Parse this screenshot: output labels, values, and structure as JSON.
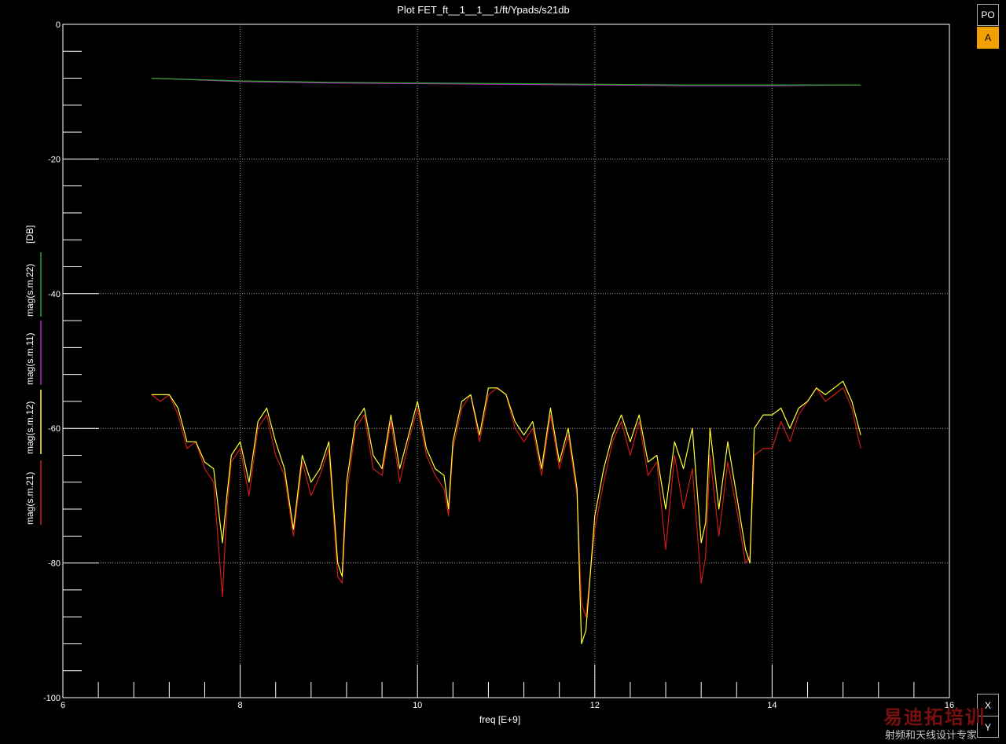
{
  "window": {
    "title": "Plot FET_ft__1__1__1/ft/Ypads/s21db",
    "buttons": {
      "po": "PO",
      "a": "A",
      "x": "X",
      "y": "Y"
    }
  },
  "watermark": {
    "top": "易迪拓培训",
    "bottom": "射频和天线设计专家"
  },
  "chart_data": {
    "type": "line",
    "title": "Plot FET_ft__1__1__1/ft/Ypads/s21db",
    "xlabel": "freq  [E+9]",
    "ylabel_unit": "[DB]",
    "xlim": [
      6,
      16
    ],
    "ylim": [
      -100,
      0
    ],
    "xticks": [
      6,
      8,
      10,
      12,
      14,
      16
    ],
    "yticks": [
      0,
      -20,
      -40,
      -60,
      -80,
      -100
    ],
    "grid": true,
    "legend": "left-vertical",
    "series": [
      {
        "name": "mag(s.m.21)",
        "color": "#d01a1a",
        "x": [
          7.0,
          7.1,
          7.2,
          7.3,
          7.4,
          7.5,
          7.6,
          7.7,
          7.8,
          7.85,
          7.9,
          8.0,
          8.1,
          8.2,
          8.3,
          8.4,
          8.5,
          8.6,
          8.7,
          8.8,
          8.9,
          9.0,
          9.1,
          9.15,
          9.2,
          9.3,
          9.4,
          9.5,
          9.6,
          9.7,
          9.8,
          9.9,
          10.0,
          10.1,
          10.2,
          10.3,
          10.35,
          10.4,
          10.5,
          10.6,
          10.7,
          10.8,
          10.9,
          11.0,
          11.1,
          11.2,
          11.3,
          11.4,
          11.5,
          11.6,
          11.7,
          11.8,
          11.85,
          11.9,
          12.0,
          12.1,
          12.2,
          12.3,
          12.4,
          12.5,
          12.6,
          12.7,
          12.8,
          12.9,
          13.0,
          13.1,
          13.2,
          13.25,
          13.3,
          13.4,
          13.5,
          13.6,
          13.7,
          13.75,
          13.8,
          13.9,
          14.0,
          14.1,
          14.2,
          14.3,
          14.4,
          14.5,
          14.6,
          14.7,
          14.8,
          14.9,
          15.0
        ],
        "y": [
          -55,
          -56,
          -55,
          -58,
          -63,
          -62,
          -66,
          -68,
          -85,
          -72,
          -65,
          -63,
          -70,
          -60,
          -58,
          -64,
          -67,
          -76,
          -65,
          -70,
          -67,
          -63,
          -82,
          -83,
          -70,
          -60,
          -58,
          -66,
          -67,
          -59,
          -68,
          -62,
          -57,
          -64,
          -67,
          -69,
          -73,
          -63,
          -57,
          -55,
          -62,
          -55,
          -54,
          -55,
          -60,
          -62,
          -60,
          -67,
          -58,
          -66,
          -61,
          -70,
          -86,
          -88,
          -75,
          -68,
          -62,
          -59,
          -64,
          -59,
          -67,
          -65,
          -78,
          -64,
          -72,
          -66,
          -83,
          -79,
          -64,
          -76,
          -65,
          -72,
          -80,
          -79,
          -64,
          -63,
          -63,
          -59,
          -62,
          -58,
          -56,
          -54,
          -56,
          -55,
          -54,
          -57,
          -63
        ]
      },
      {
        "name": "mag(s.m.12)",
        "color": "#ffff33",
        "x": [
          7.0,
          7.1,
          7.2,
          7.3,
          7.4,
          7.5,
          7.6,
          7.7,
          7.8,
          7.85,
          7.9,
          8.0,
          8.1,
          8.2,
          8.3,
          8.4,
          8.5,
          8.6,
          8.7,
          8.8,
          8.9,
          9.0,
          9.1,
          9.15,
          9.2,
          9.3,
          9.4,
          9.5,
          9.6,
          9.7,
          9.8,
          9.9,
          10.0,
          10.1,
          10.2,
          10.3,
          10.35,
          10.4,
          10.5,
          10.6,
          10.7,
          10.8,
          10.9,
          11.0,
          11.1,
          11.2,
          11.3,
          11.4,
          11.5,
          11.6,
          11.7,
          11.8,
          11.85,
          11.9,
          12.0,
          12.1,
          12.2,
          12.3,
          12.4,
          12.5,
          12.6,
          12.7,
          12.8,
          12.9,
          13.0,
          13.1,
          13.2,
          13.25,
          13.3,
          13.4,
          13.5,
          13.6,
          13.7,
          13.75,
          13.8,
          13.9,
          14.0,
          14.1,
          14.2,
          14.3,
          14.4,
          14.5,
          14.6,
          14.7,
          14.8,
          14.9,
          15.0
        ],
        "y": [
          -55,
          -55,
          -55,
          -57,
          -62,
          -62,
          -65,
          -66,
          -77,
          -70,
          -64,
          -62,
          -68,
          -59,
          -57,
          -62,
          -66,
          -75,
          -64,
          -68,
          -66,
          -62,
          -80,
          -82,
          -68,
          -59,
          -57,
          -64,
          -66,
          -58,
          -66,
          -61,
          -56,
          -63,
          -66,
          -67,
          -72,
          -62,
          -56,
          -55,
          -61,
          -54,
          -54,
          -55,
          -59,
          -61,
          -59,
          -66,
          -57,
          -65,
          -60,
          -69,
          -92,
          -90,
          -73,
          -66,
          -61,
          -58,
          -62,
          -58,
          -65,
          -64,
          -72,
          -62,
          -66,
          -60,
          -77,
          -74,
          -60,
          -72,
          -62,
          -70,
          -78,
          -80,
          -60,
          -58,
          -58,
          -57,
          -60,
          -57,
          -56,
          -54,
          -55,
          -54,
          -53,
          -56,
          -61
        ]
      },
      {
        "name": "mag(s.m.11)",
        "color": "#b02cc0",
        "x": [
          7.0,
          8.0,
          9.0,
          10.0,
          11.0,
          12.0,
          13.0,
          14.0,
          15.0
        ],
        "y": [
          -8.0,
          -8.5,
          -8.7,
          -8.8,
          -8.9,
          -9.0,
          -9.1,
          -9.1,
          -9.0
        ]
      },
      {
        "name": "mag(s.m.22)",
        "color": "#2ea02e",
        "x": [
          7.0,
          8.0,
          9.0,
          10.0,
          11.0,
          12.0,
          13.0,
          14.0,
          15.0
        ],
        "y": [
          -8.0,
          -8.4,
          -8.6,
          -8.7,
          -8.8,
          -8.9,
          -9.0,
          -9.0,
          -9.0
        ]
      }
    ]
  }
}
